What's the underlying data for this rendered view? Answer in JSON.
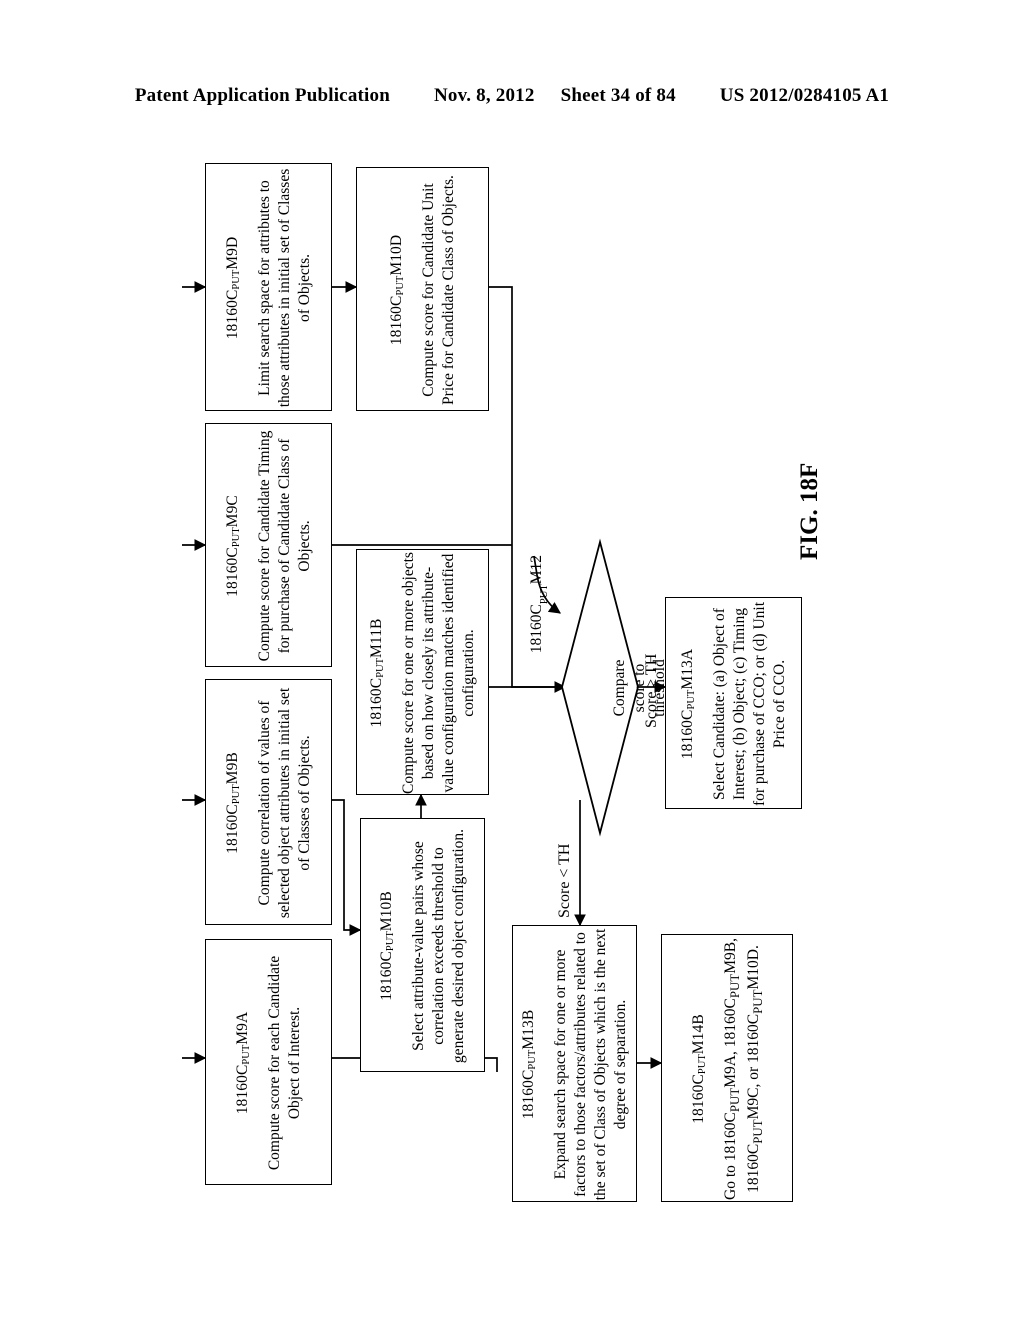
{
  "header": {
    "publication": "Patent Application Publication",
    "date": "Nov. 8, 2012",
    "sheet": "Sheet 34 of 84",
    "number": "US 2012/0284105 A1"
  },
  "figure": {
    "label": "FIG. 18F"
  },
  "diagram": {
    "type": "flowchart",
    "orientation": "rotated-90-ccw",
    "nodes": [
      {
        "id": "m9d",
        "shape": "process",
        "ref_prefix": "18160C",
        "ref_sub": "PUT",
        "ref_suffix": "M9D",
        "text": "Limit search space for attributes to those attributes in initial set of Classes of Objects."
      },
      {
        "id": "m10d",
        "shape": "process",
        "ref_prefix": "18160C",
        "ref_sub": "PUT",
        "ref_suffix": "M10D",
        "text": "Compute score for Candidate Unit Price for Candidate Class of Objects."
      },
      {
        "id": "m9c",
        "shape": "process",
        "ref_prefix": "18160C",
        "ref_sub": "PUT",
        "ref_suffix": "M9C",
        "text": "Compute score for Candidate Timing for purchase of Candidate Class of Objects."
      },
      {
        "id": "m9b",
        "shape": "process",
        "ref_prefix": "18160C",
        "ref_sub": "PUT",
        "ref_suffix": "M9B",
        "text": "Compute correlation of values of selected object attributes in initial set of Classes of Objects."
      },
      {
        "id": "m9a",
        "shape": "process",
        "ref_prefix": "18160C",
        "ref_sub": "PUT",
        "ref_suffix": "M9A",
        "text": "Compute score for each Candidate Object of Interest."
      },
      {
        "id": "m11b",
        "shape": "process",
        "ref_prefix": "18160C",
        "ref_sub": "PUT",
        "ref_suffix": "M11B",
        "text": "Compute score for one or more objects based on how closely its attribute-value configuration matches identified configuration."
      },
      {
        "id": "m10b",
        "shape": "process",
        "ref_prefix": "18160C",
        "ref_sub": "PUT",
        "ref_suffix": "M10B",
        "text": "Select attribute-value pairs whose correlation exceeds threshold to generate desired object configuration."
      },
      {
        "id": "m12",
        "shape": "decision",
        "ref_prefix": "18160C",
        "ref_sub": "PUT",
        "ref_suffix": "M12",
        "text": "Compare score to threshold"
      },
      {
        "id": "m13a",
        "shape": "process",
        "ref_prefix": "18160C",
        "ref_sub": "PUT",
        "ref_suffix": "M13A",
        "text": "Select Candidate: (a) Object of Interest; (b) Object; (c) Timing for purchase of CCO; or (d) Unit Price of CCO."
      },
      {
        "id": "m13b",
        "shape": "process",
        "ref_prefix": "18160C",
        "ref_sub": "PUT",
        "ref_suffix": "M13B",
        "text": "Expand search space for one or more factors to those factors/attributes related to the set of Class of Objects which is the next degree of separation."
      },
      {
        "id": "m14b",
        "shape": "process",
        "ref_prefix": "18160C",
        "ref_sub": "PUT",
        "ref_suffix": "M14B",
        "text": "Go to 18160CPUTM9A, 18160CPUTM9B, 18160CPUTM9C, or 18160CPUTM10D."
      }
    ],
    "edge_labels": {
      "score_ge": "Score ≥ TH",
      "score_lt": "Score < TH"
    }
  }
}
